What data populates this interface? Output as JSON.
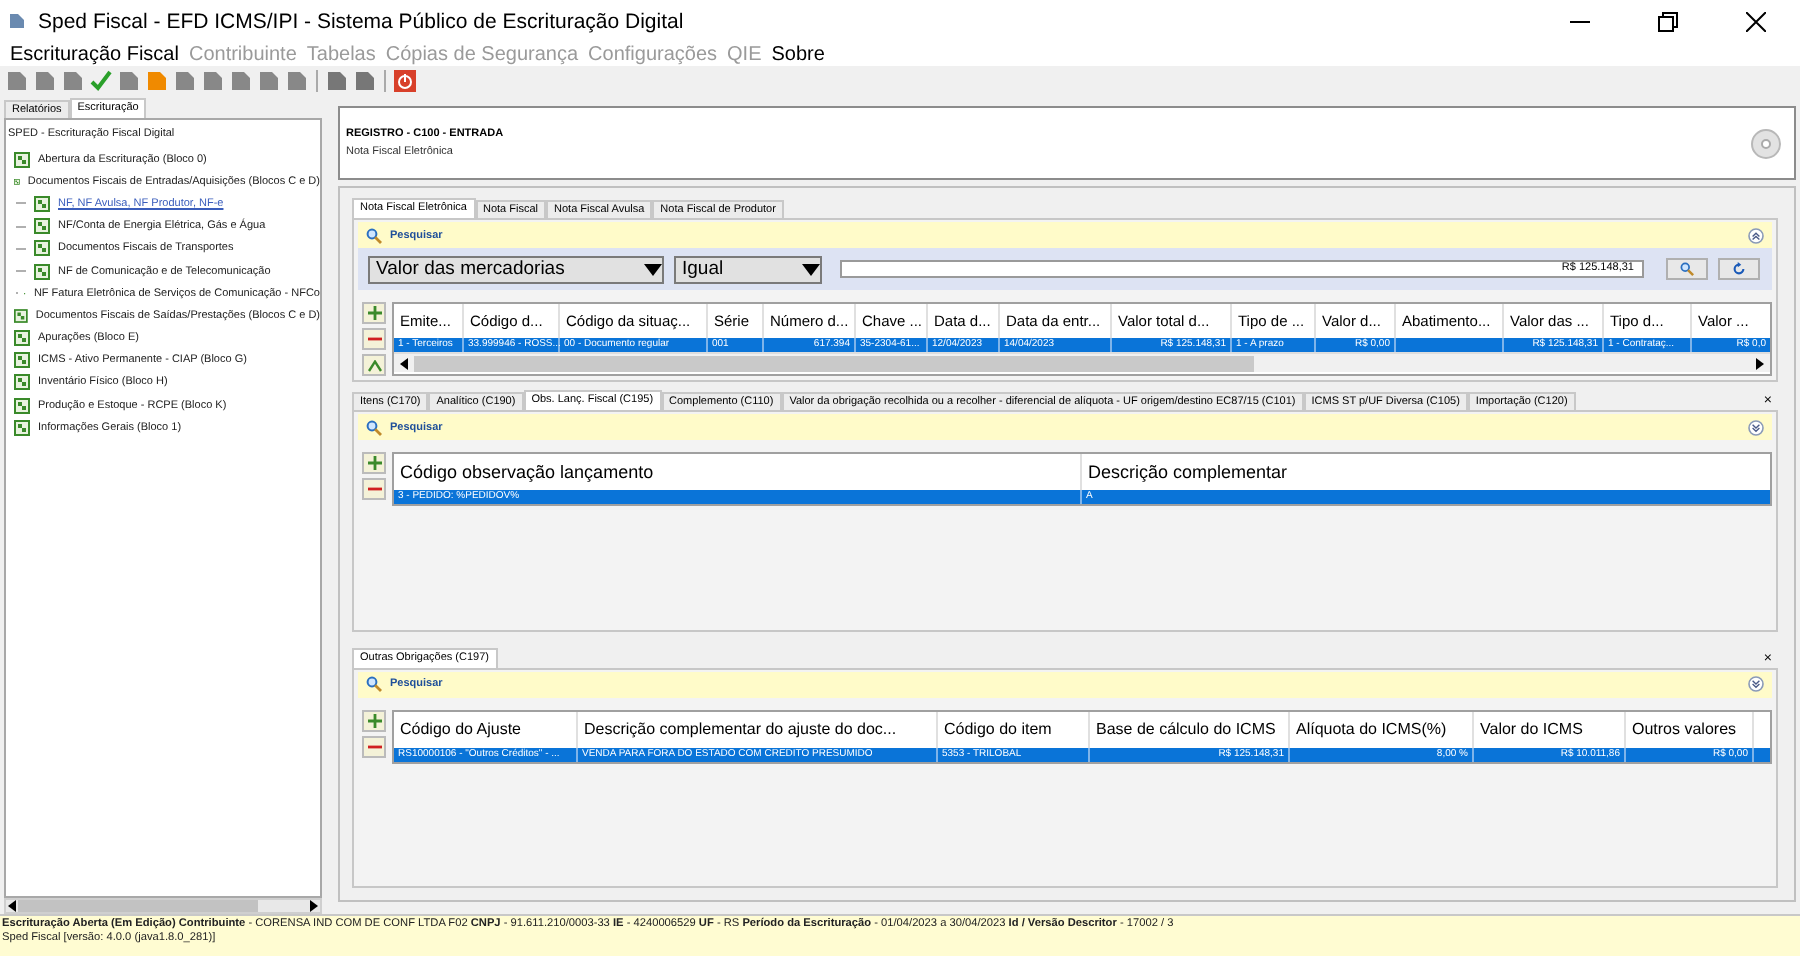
{
  "window": {
    "title": "Sped Fiscal - EFD ICMS/IPI - Sistema Público de Escrituração Digital"
  },
  "menu": [
    {
      "label": "Escrituração Fiscal",
      "disabled": false
    },
    {
      "label": "Contribuinte",
      "disabled": true
    },
    {
      "label": "Tabelas",
      "disabled": true
    },
    {
      "label": "Cópias de Segurança",
      "disabled": true
    },
    {
      "label": "Configurações",
      "disabled": true
    },
    {
      "label": "QIE",
      "disabled": true
    },
    {
      "label": "Sobre",
      "disabled": false
    }
  ],
  "sidebar": {
    "tabs": [
      {
        "label": "Relatórios",
        "selected": false
      },
      {
        "label": "Escrituração",
        "selected": true
      }
    ],
    "tree": {
      "label": "SPED - Escrituração Fiscal Digital",
      "children": [
        {
          "label": "Abertura da Escrituração (Bloco 0)",
          "selected": false
        },
        {
          "label": "Documentos Fiscais de Entradas/Aquisições (Blocos C e D)",
          "selected": false,
          "children": [
            {
              "label": "NF, NF Avulsa, NF Produtor, NF-e",
              "selected": true
            },
            {
              "label": "NF/Conta de Energia Elétrica, Gás e Água",
              "selected": false
            },
            {
              "label": "Documentos Fiscais de Transportes",
              "selected": false
            },
            {
              "label": "NF de Comunicação e de Telecomunicação",
              "selected": false
            },
            {
              "label": "NF Fatura Eletrônica de Serviços de Comunicação - NFCo",
              "selected": false
            }
          ]
        },
        {
          "label": "Documentos Fiscais de Saídas/Prestações (Blocos C e D)",
          "selected": false
        },
        {
          "label": "Apurações (Bloco E)",
          "selected": false
        },
        {
          "label": "ICMS - Ativo Permanente - CIAP (Bloco G)",
          "selected": false
        },
        {
          "label": "Inventário Físico (Bloco H)",
          "selected": false
        },
        {
          "label": "Produção e Estoque - RCPE (Bloco K)",
          "selected": false
        },
        {
          "label": "Informações Gerais (Bloco 1)",
          "selected": false
        }
      ]
    }
  },
  "record": {
    "title": "REGISTRO - C100 - ENTRADA",
    "subtitle": "Nota Fiscal Eletrônica"
  },
  "document_tabs": [
    {
      "label": "Nota Fiscal Eletrônica",
      "selected": true
    },
    {
      "label": "Nota Fiscal",
      "selected": false
    },
    {
      "label": "Nota Fiscal Avulsa",
      "selected": false
    },
    {
      "label": "Nota Fiscal de Produtor",
      "selected": false
    }
  ],
  "document_search": {
    "title": "Pesquisar",
    "expanded": true,
    "field": "Valor das mercadorias",
    "operator": "Igual",
    "value": "R$ 125.148,31"
  },
  "document_table": {
    "columns": [
      "Emite...",
      "Código d...",
      "Código da situaç...",
      "Série",
      "Número d...",
      "Chave ...",
      "Data d...",
      "Data da entr...",
      "Valor total d...",
      "Tipo de ...",
      "Valor d...",
      "Abatimento...",
      "Valor das ...",
      "Tipo d...",
      "Valor ..."
    ],
    "rows": [
      {
        "selected": true,
        "cells": [
          "1 - Terceiros",
          "33.999946 - ROSS...",
          "00 - Documento regular",
          "001",
          "617.394",
          "35-2304-61...",
          "12/04/2023",
          "14/04/2023",
          "R$ 125.148,31",
          "1 - A prazo",
          "R$ 0,00",
          null,
          "R$ 125.148,31",
          "1 - Contrataç...",
          "R$ 0,0"
        ]
      }
    ]
  },
  "detail_tabs": [
    {
      "label": "Itens (C170)",
      "selected": false
    },
    {
      "label": "Analítico (C190)",
      "selected": false
    },
    {
      "label": "Obs. Lanç. Fiscal (C195)",
      "selected": true
    },
    {
      "label": "Complemento (C110)",
      "selected": false
    },
    {
      "label": "Valor da obrigação recolhida ou a recolher - diferencial de alíquota - UF origem/destino EC87/15 (C101)",
      "selected": false
    },
    {
      "label": "ICMS ST p/UF Diversa (C105)",
      "selected": false
    },
    {
      "label": "Importação (C120)",
      "selected": false
    }
  ],
  "detail_close": "×",
  "obligation_close": "×",
  "detail_search": {
    "title": "Pesquisar",
    "expanded": false
  },
  "detail_table": {
    "columns": [
      "Código observação lançamento",
      "Descrição complementar"
    ],
    "rows": [
      {
        "selected": true,
        "cells": [
          "3 - PEDIDO: %PEDIDOV%",
          "A"
        ]
      }
    ]
  },
  "obligation_tabs": [
    {
      "label": "Outras Obrigações (C197)",
      "selected": true
    }
  ],
  "obligation_search": {
    "title": "Pesquisar",
    "expanded": false
  },
  "obligation_table": {
    "columns": [
      "Código do Ajuste",
      "Descrição complementar do ajuste do doc...",
      "Código do item",
      "Base de cálculo do ICMS",
      "Alíquota do ICMS(%)",
      "Valor do ICMS",
      "Outros valores"
    ],
    "rows": [
      {
        "selected": true,
        "cells": [
          "RS10000106 - \"Outros Créditos\" - ...",
          "VENDA PARA FORA DO ESTADO COM CREDITO PRESUMIDO",
          "5353 - TRILOBAL",
          "R$ 125.148,31",
          "8,00 %",
          "R$ 10.011,86",
          "R$ 0,00"
        ]
      }
    ]
  },
  "status_bar": {
    "line_1": "**Escrituração Aberta (Em Edição) Contribuinte** - CORENSA IND COM DE CONF LTDA F02 **CNPJ** - 91.611.210/0003-33 **IE** - 4240006529 **UF** - RS **Período da Escrituração** - 01/04/2023 a 30/04/2023 **Id / Versão Descritor** - 17002 / 3",
    "line_2": "Sped Fiscal [versão: 4.0.0 (java1.8.0_281)]"
  }
}
